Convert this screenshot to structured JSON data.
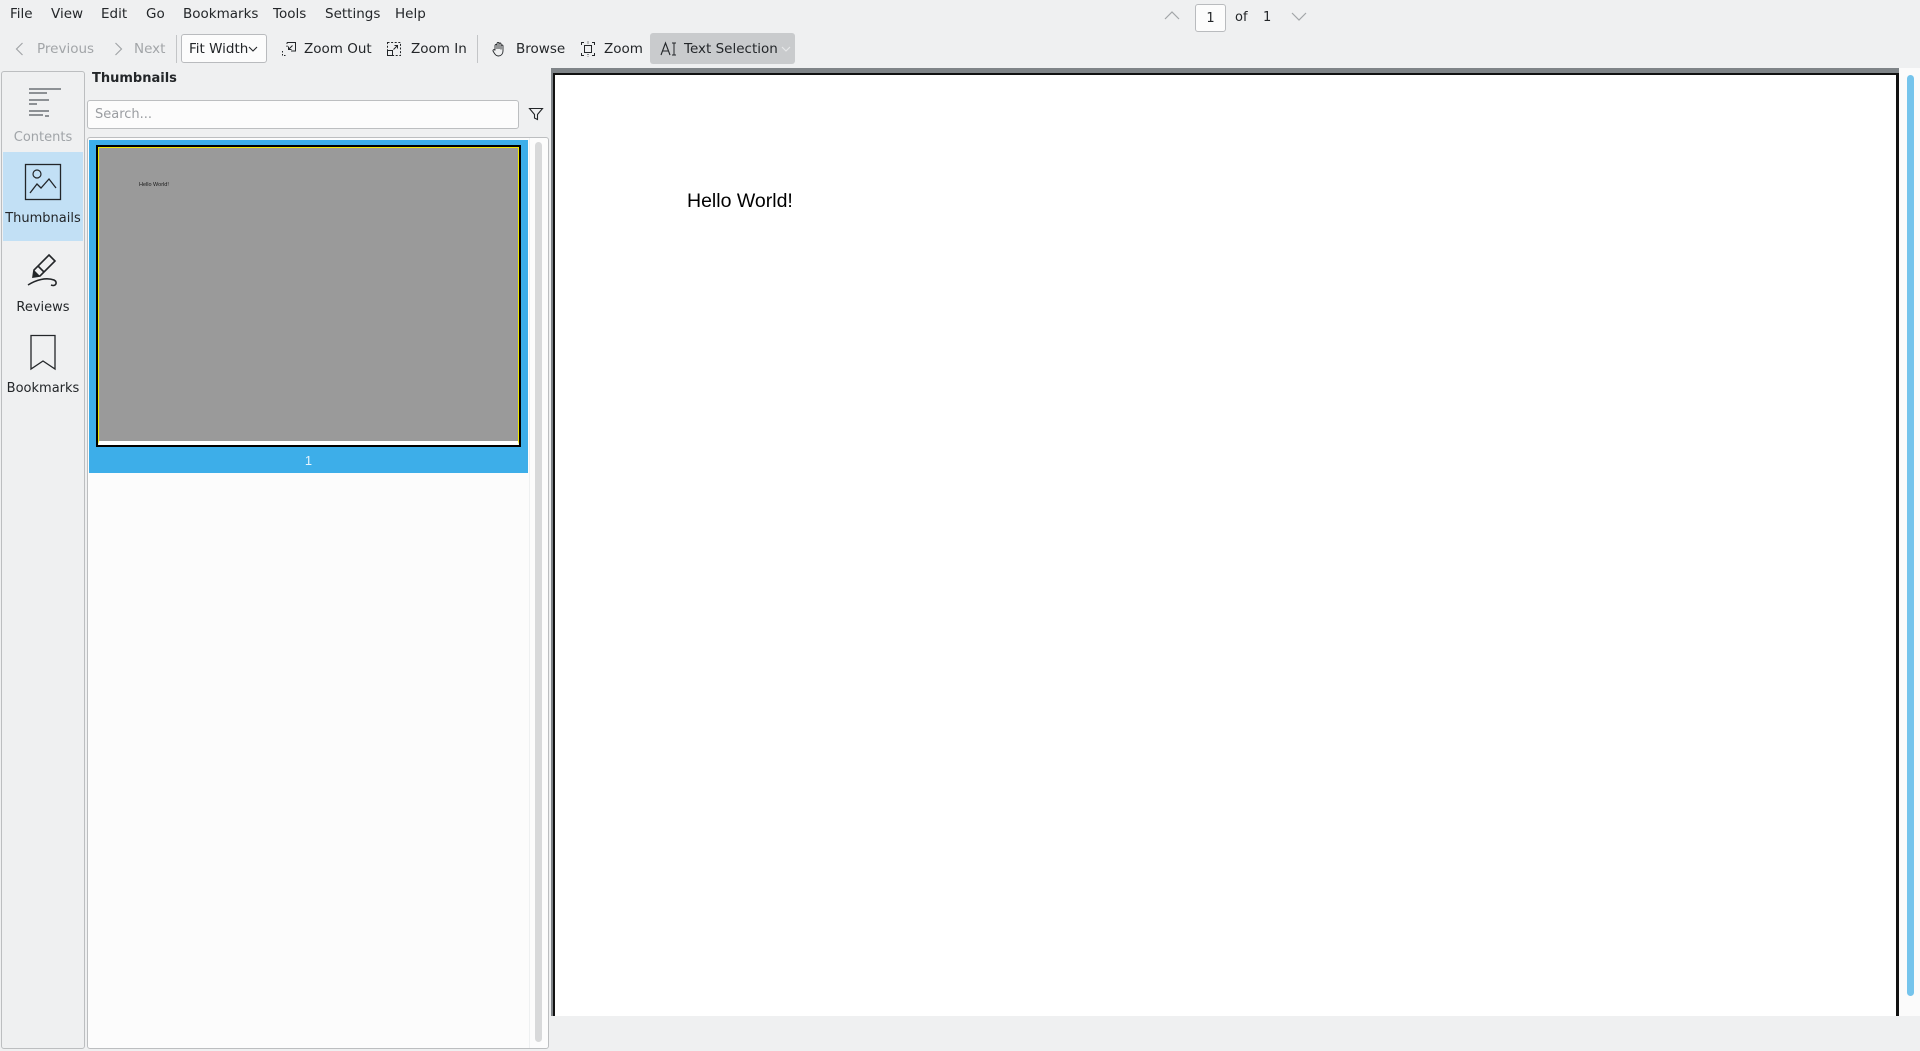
{
  "menu": {
    "items": [
      "File",
      "View",
      "Edit",
      "Go",
      "Bookmarks",
      "Tools",
      "Settings",
      "Help"
    ]
  },
  "toolbar": {
    "previous_label": "Previous",
    "next_label": "Next",
    "zoom_mode": "Fit Width",
    "zoom_out_label": "Zoom Out",
    "zoom_in_label": "Zoom In",
    "browse_label": "Browse",
    "zoom_label": "Zoom",
    "text_selection_label": "Text Selection"
  },
  "sidebar": {
    "items": [
      {
        "label": "Contents",
        "icon": "contents-icon",
        "enabled": false
      },
      {
        "label": "Thumbnails",
        "icon": "thumbnails-icon",
        "selected": true
      },
      {
        "label": "Reviews",
        "icon": "reviews-icon"
      },
      {
        "label": "Bookmarks",
        "icon": "bookmarks-icon"
      }
    ]
  },
  "thumbnails": {
    "title": "Thumbnails",
    "search_placeholder": "Search...",
    "search_value": "",
    "pages": [
      {
        "number": "1",
        "text": "Hello World!",
        "selected": true
      }
    ]
  },
  "document": {
    "page_text": "Hello World!"
  },
  "pagebar": {
    "current_page": "1",
    "of_label": "of",
    "total_pages": "1"
  },
  "colors": {
    "accent": "#3daee9",
    "selected_nav_bg": "#c2e0f5",
    "window_bg": "#eff0f1"
  }
}
